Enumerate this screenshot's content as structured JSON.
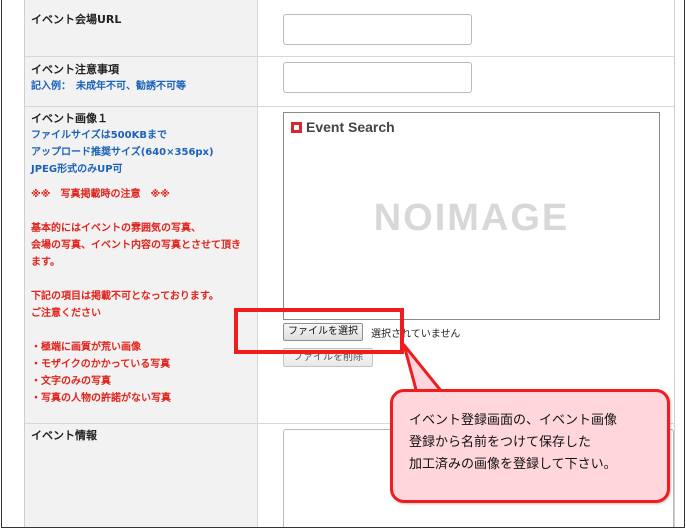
{
  "fields": {
    "venue_url": {
      "label": "イベント会場URL",
      "value": ""
    },
    "notes": {
      "label": "イベント注意事項",
      "example": "記入例：　未成年不可、勧誘不可等",
      "value": ""
    },
    "image": {
      "label": "イベント画像１",
      "spec_lines": [
        "ファイルサイズは500KBまで",
        "アップロード推奨サイズ(640×356px)",
        "JPEG形式のみUP可"
      ],
      "warning_lines": [
        "※※　写真掲載時の注意　※※",
        "",
        "基本的にはイベントの雰囲気の写真、",
        "会場の写真、イベント内容の写真とさせて頂き",
        "ます。",
        "",
        "下記の項目は掲載不可となっております。",
        "ご注意ください",
        "",
        "・極端に画質が荒い画像",
        "・モザイクのかかっている写真",
        "・文字のみの写真",
        "・写真の人物の許諾がない写真"
      ],
      "preview_logo": "Event Search",
      "preview_placeholder": "NOIMAGE",
      "choose_file_label": "ファイルを選択",
      "file_status": "選択されていません",
      "delete_file_label": "ファイルを削除"
    },
    "info": {
      "label": "イベント情報",
      "value": ""
    }
  },
  "callout": {
    "lines": [
      "イベント登録画面の、イベント画像",
      "登録から名前をつけて保存した",
      "加工済みの画像を登録して下さい。"
    ]
  },
  "colors": {
    "highlight": "#ef1d1d",
    "callout_fill": "#ffd6dc",
    "note_blue": "#1a62b8",
    "note_red": "#e0231c",
    "logo_red": "#d9262b"
  }
}
